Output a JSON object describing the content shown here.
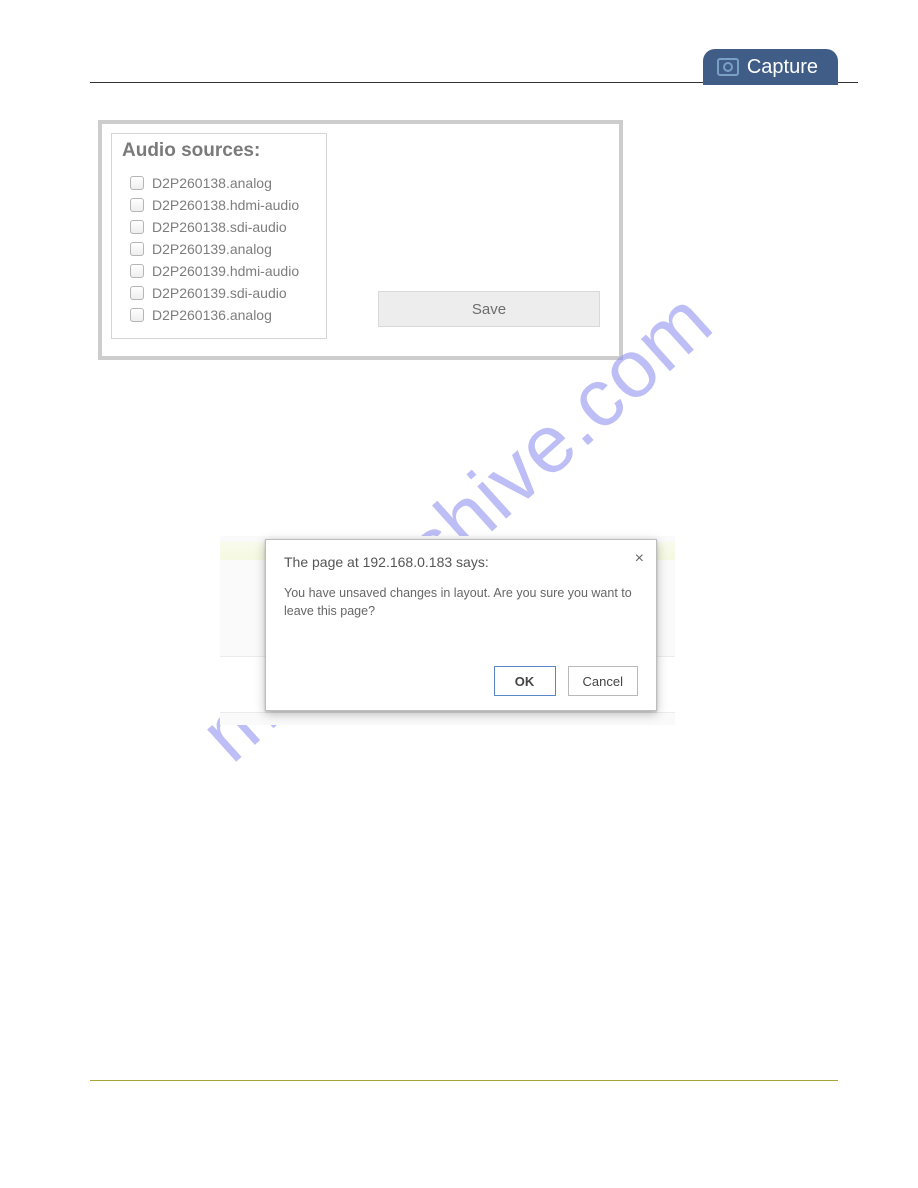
{
  "header": {
    "capture_label": "Capture"
  },
  "audio_panel": {
    "title": "Audio sources:",
    "items": [
      {
        "label": "D2P260138.analog"
      },
      {
        "label": "D2P260138.hdmi-audio"
      },
      {
        "label": "D2P260138.sdi-audio"
      },
      {
        "label": "D2P260139.analog"
      },
      {
        "label": "D2P260139.hdmi-audio"
      },
      {
        "label": "D2P260139.sdi-audio"
      },
      {
        "label": "D2P260136.analog"
      }
    ],
    "save_label": "Save"
  },
  "dialog": {
    "title": "The page at 192.168.0.183 says:",
    "message": "You have unsaved changes in layout. Are you sure you want to leave this page?",
    "ok_label": "OK",
    "cancel_label": "Cancel"
  },
  "watermark": "manualshive.com"
}
